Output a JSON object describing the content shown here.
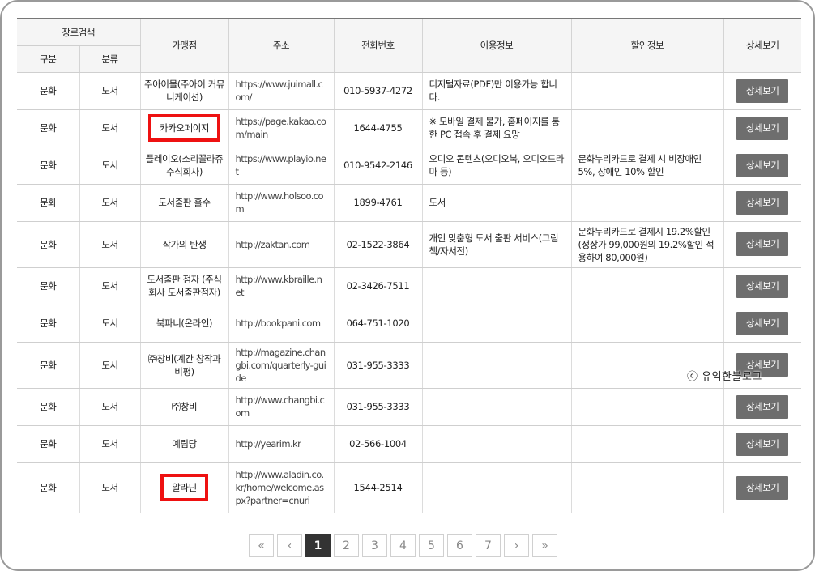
{
  "header": {
    "genre_search": "장르검색",
    "category": "구분",
    "classification": "분류",
    "merchant": "가맹점",
    "address": "주소",
    "phone": "전화번호",
    "usage_info": "이용정보",
    "discount_info": "할인정보",
    "details": "상세보기"
  },
  "rows": [
    {
      "category": "문화",
      "classification": "도서",
      "merchant": "주아이몰(주아이 커뮤니케이션)",
      "url": "https://www.juimall.com/",
      "phone": "010-5937-4272",
      "usage": "디지털자료(PDF)만 이용가능 합니다.",
      "discount": "",
      "button": "상세보기"
    },
    {
      "category": "문화",
      "classification": "도서",
      "merchant": "카카오페이지",
      "url": "https://page.kakao.com/main",
      "phone": "1644-4755",
      "usage": "※ 모바일 결제 불가, 홈페이지를 통한 PC 접속 후 결제 요망",
      "discount": "",
      "button": "상세보기"
    },
    {
      "category": "문화",
      "classification": "도서",
      "merchant": "플레이오(소리꼴라쥬 주식회사)",
      "url": "https://www.playio.net",
      "phone": "010-9542-2146",
      "usage": "오디오 콘텐츠(오디오북, 오디오드라마 등)",
      "discount": "문화누리카드로 결제 시 비장애인 5%, 장애인 10% 할인",
      "button": "상세보기"
    },
    {
      "category": "문화",
      "classification": "도서",
      "merchant": "도서출판 홀수",
      "url": "http://www.holsoo.com",
      "phone": "1899-4761",
      "usage": "도서",
      "discount": "",
      "button": "상세보기"
    },
    {
      "category": "문화",
      "classification": "도서",
      "merchant": "작가의 탄생",
      "url": "http://zaktan.com",
      "phone": "02-1522-3864",
      "usage": "개인 맞춤형 도서 출판 서비스(그림책/자서전)",
      "discount": "문화누리카드로 결제시 19.2%할인 (정상가 99,000원의 19.2%할인 적용하여 80,000원)",
      "button": "상세보기"
    },
    {
      "category": "문화",
      "classification": "도서",
      "merchant": "도서출판 점자 (주식회사 도서출판점자)",
      "url": "http://www.kbraille.net",
      "phone": "02-3426-7511",
      "usage": "",
      "discount": "",
      "button": "상세보기"
    },
    {
      "category": "문화",
      "classification": "도서",
      "merchant": "북파니(온라인)",
      "url": "http://bookpani.com",
      "phone": "064-751-1020",
      "usage": "",
      "discount": "",
      "button": "상세보기"
    },
    {
      "category": "문화",
      "classification": "도서",
      "merchant": "㈜창비(계간 창작과 비평)",
      "url": "http://magazine.changbi.com/quarterly-guide",
      "phone": "031-955-3333",
      "usage": "",
      "discount": "",
      "button": "상세보기"
    },
    {
      "category": "문화",
      "classification": "도서",
      "merchant": "㈜창비",
      "url": "http://www.changbi.com",
      "phone": "031-955-3333",
      "usage": "",
      "discount": "",
      "button": "상세보기"
    },
    {
      "category": "문화",
      "classification": "도서",
      "merchant": "예림당",
      "url": "http://yearim.kr",
      "phone": "02-566-1004",
      "usage": "",
      "discount": "",
      "button": "상세보기"
    },
    {
      "category": "문화",
      "classification": "도서",
      "merchant": "알라딘",
      "url": "http://www.aladin.co.kr/home/welcome.aspx?partner=cnuri",
      "phone": "1544-2514",
      "usage": "",
      "discount": "",
      "button": "상세보기"
    }
  ],
  "watermark": "ⓒ 유익한블로그",
  "pagination": {
    "first": "«",
    "prev": "‹",
    "pages": [
      "1",
      "2",
      "3",
      "4",
      "5",
      "6",
      "7"
    ],
    "current": "1",
    "next": "›",
    "last": "»"
  }
}
